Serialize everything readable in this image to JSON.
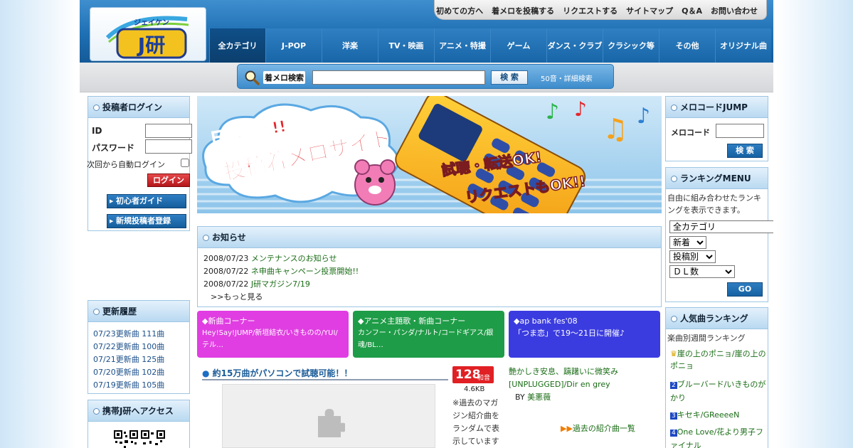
{
  "util_nav": [
    "初めての方へ",
    "着メロを投稿する",
    "リクエストする",
    "サイトマップ",
    "Q＆A",
    "お問い合わせ"
  ],
  "logo": {
    "top": "ジェイケン",
    "main": "J研"
  },
  "nav": [
    "全カテゴリ",
    "J-POP",
    "洋楽",
    "TV・映画",
    "アニメ・特撮",
    "ゲーム",
    "ダンス・クラブ",
    "クラシック等",
    "その他",
    "オリジナル曲"
  ],
  "search": {
    "label": "着メロ検索",
    "button": "検 索",
    "advanced": "50音・詳細検索",
    "placeholder": ""
  },
  "login": {
    "title": "投稿者ログイン",
    "id_label": "ID",
    "pw_label": "パスワード",
    "auto_label": "次回から自動ログイン",
    "button": "ログイン",
    "guide": "初心者ガイド",
    "register": "新規投稿者登録"
  },
  "history": {
    "title": "更新履歴",
    "items": [
      "07/23更新曲 111曲",
      "07/22更新曲 100曲",
      "07/21更新曲 125曲",
      "07/20更新曲 102曲",
      "07/19更新曲 105曲"
    ]
  },
  "mobile": {
    "title": "携帯J研へアクセス"
  },
  "banner": {
    "l1": "日本最大!!",
    "l2": "投稿着メロサイト",
    "r1": "試聴・転送OK!",
    "r2": "リクエストもOK!!"
  },
  "news": {
    "title": "お知らせ",
    "items": [
      {
        "date": "2008/07/23",
        "text": "メンテナンスのお知らせ"
      },
      {
        "date": "2008/07/22",
        "text": "ネ申曲キャンペーン投票開始!!"
      },
      {
        "date": "2008/07/22",
        "text": "J研マガジン7/19"
      }
    ],
    "more": ">>もっと見る"
  },
  "tiles": [
    {
      "title": "◆新曲コーナー",
      "body": "Hey!Say!JUMP/新垣結衣/いきものの/YUI/テル…",
      "color": "#e03ee2"
    },
    {
      "title": "◆アニメ主題歌・新曲コーナー",
      "body": "カンフー・パンダ/ナルト/コードギアス/銀魂/BL…",
      "color": "#1f9c47"
    },
    {
      "title": "◆ap bank fes'08",
      "body": "「つま恋」で19〜21日に開催♪",
      "color": "#3b3ce0"
    }
  ],
  "promo": {
    "title": "約15万曲がパソコンで試聴可能！！"
  },
  "magazine": {
    "badge_num": "128",
    "badge_unit": "和音",
    "size": "4.6KB",
    "song": "艶かしき安息、躊躇いに微笑み[UNPLUGGED]/Dir en grey",
    "by_label": "BY",
    "author": "美悪薇",
    "note": "※過去のマガジン紹介曲をランダムで表示しています",
    "past_link": "過去の紹介曲一覧"
  },
  "melo_jump": {
    "title": "メロコードJUMP",
    "label": "メロコード",
    "button": "検 索"
  },
  "ranking_menu": {
    "title": "ランキングMENU",
    "desc": "自由に組み合わせたランキングを表示できます。",
    "sel1": "全カテゴリ",
    "sel2": "新着",
    "sel3": "投稿別",
    "sel4": "ＤＬ数",
    "button": "GO"
  },
  "popular": {
    "title": "人気曲ランキング",
    "subtitle": "楽曲別週間ランキング",
    "items": [
      "崖の上のポニョ/崖の上のポニョ",
      "ブルーバード/いきものがかり",
      "キセキ/GReeeeN",
      "One Love/花より男子ファイナル"
    ]
  },
  "colors": {
    "header_blue": "#1e6fb3",
    "link_green": "#1a6c16",
    "accent_red": "#c41d21"
  }
}
